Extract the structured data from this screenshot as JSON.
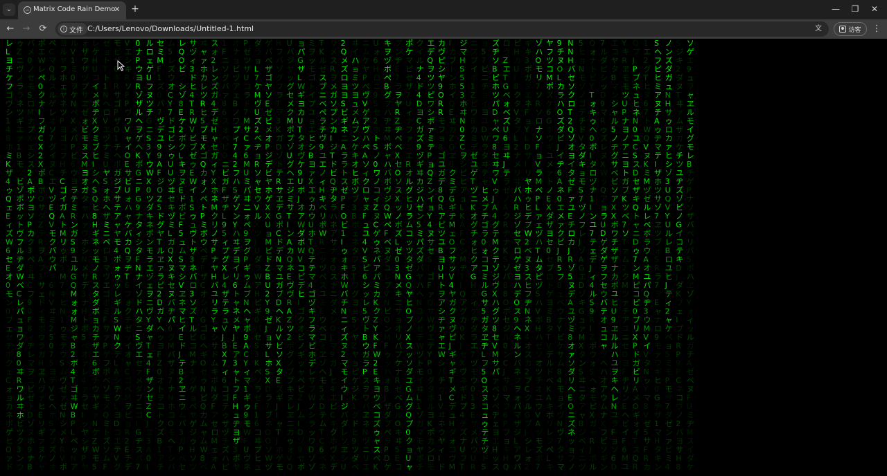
{
  "tab": {
    "title": "Matrix Code Rain Demo",
    "close_glyph": "✕"
  },
  "tabstrip": {
    "search_glyph": "⌄",
    "new_tab_glyph": "+"
  },
  "window_controls": {
    "minimize": "—",
    "restore": "❐",
    "close": "✕"
  },
  "toolbar": {
    "back_glyph": "←",
    "forward_glyph": "→",
    "reload_glyph": "⟳",
    "site_chip_label": "文件",
    "url": "C:/Users/Lenovo/Downloads/Untitled-1.html",
    "translate_glyph": "文",
    "guest_label": "访客",
    "menu_glyph": "⋮"
  },
  "page": {
    "background": "#000000",
    "glyph_color": "#00ff00",
    "charset": "アァカサタナハマヤャラワガザダバパイィキシチニヒミリヰギジヂビピウゥクスツヌフムユュルグズブヅプエェケセテネヘメレヱゲゼデベペオォコソトノホモヨョロヲゴゾドボポヴッン0123456789ABCDEFGHIJKLMNOPQRSTUVWXYZ",
    "columns": [
      "レLヨチケフ",
      "",
      "",
      "",
      "",
      "",
      "",
      "",
      "",
      "",
      "",
      "",
      "0ナPウヨRゾザルヘ",
      "ルロェゲUフヌツチ",
      "セミM",
      "",
      "レQOビ",
      "",
      "",
      "",
      "",
      "",
      "",
      "",
      "",
      "",
      "",
      "",
      "",
      "",
      "",
      "2QメズロヨヨSビギネ",
      "",
      "",
      "",
      "キヲヅボペBグ",
      "",
      "ポケ",
      "",
      "エデQヲツ",
      "カヴピシヤ9ORR",
      "",
      "",
      "",
      "",
      "ズヂソBピホツパ",
      "",
      "",
      "",
      "ゾハOモリ",
      "ヤフツコMポ",
      "9チヌ",
      "NNHバセソクロT2Qゾオヨ",
      "",
      "",
      "",
      "",
      "",
      "",
      "",
      "SヘフピヒミアヌチA",
      "ノンズダガュ",
      "",
      "ソゲ"
    ]
  }
}
